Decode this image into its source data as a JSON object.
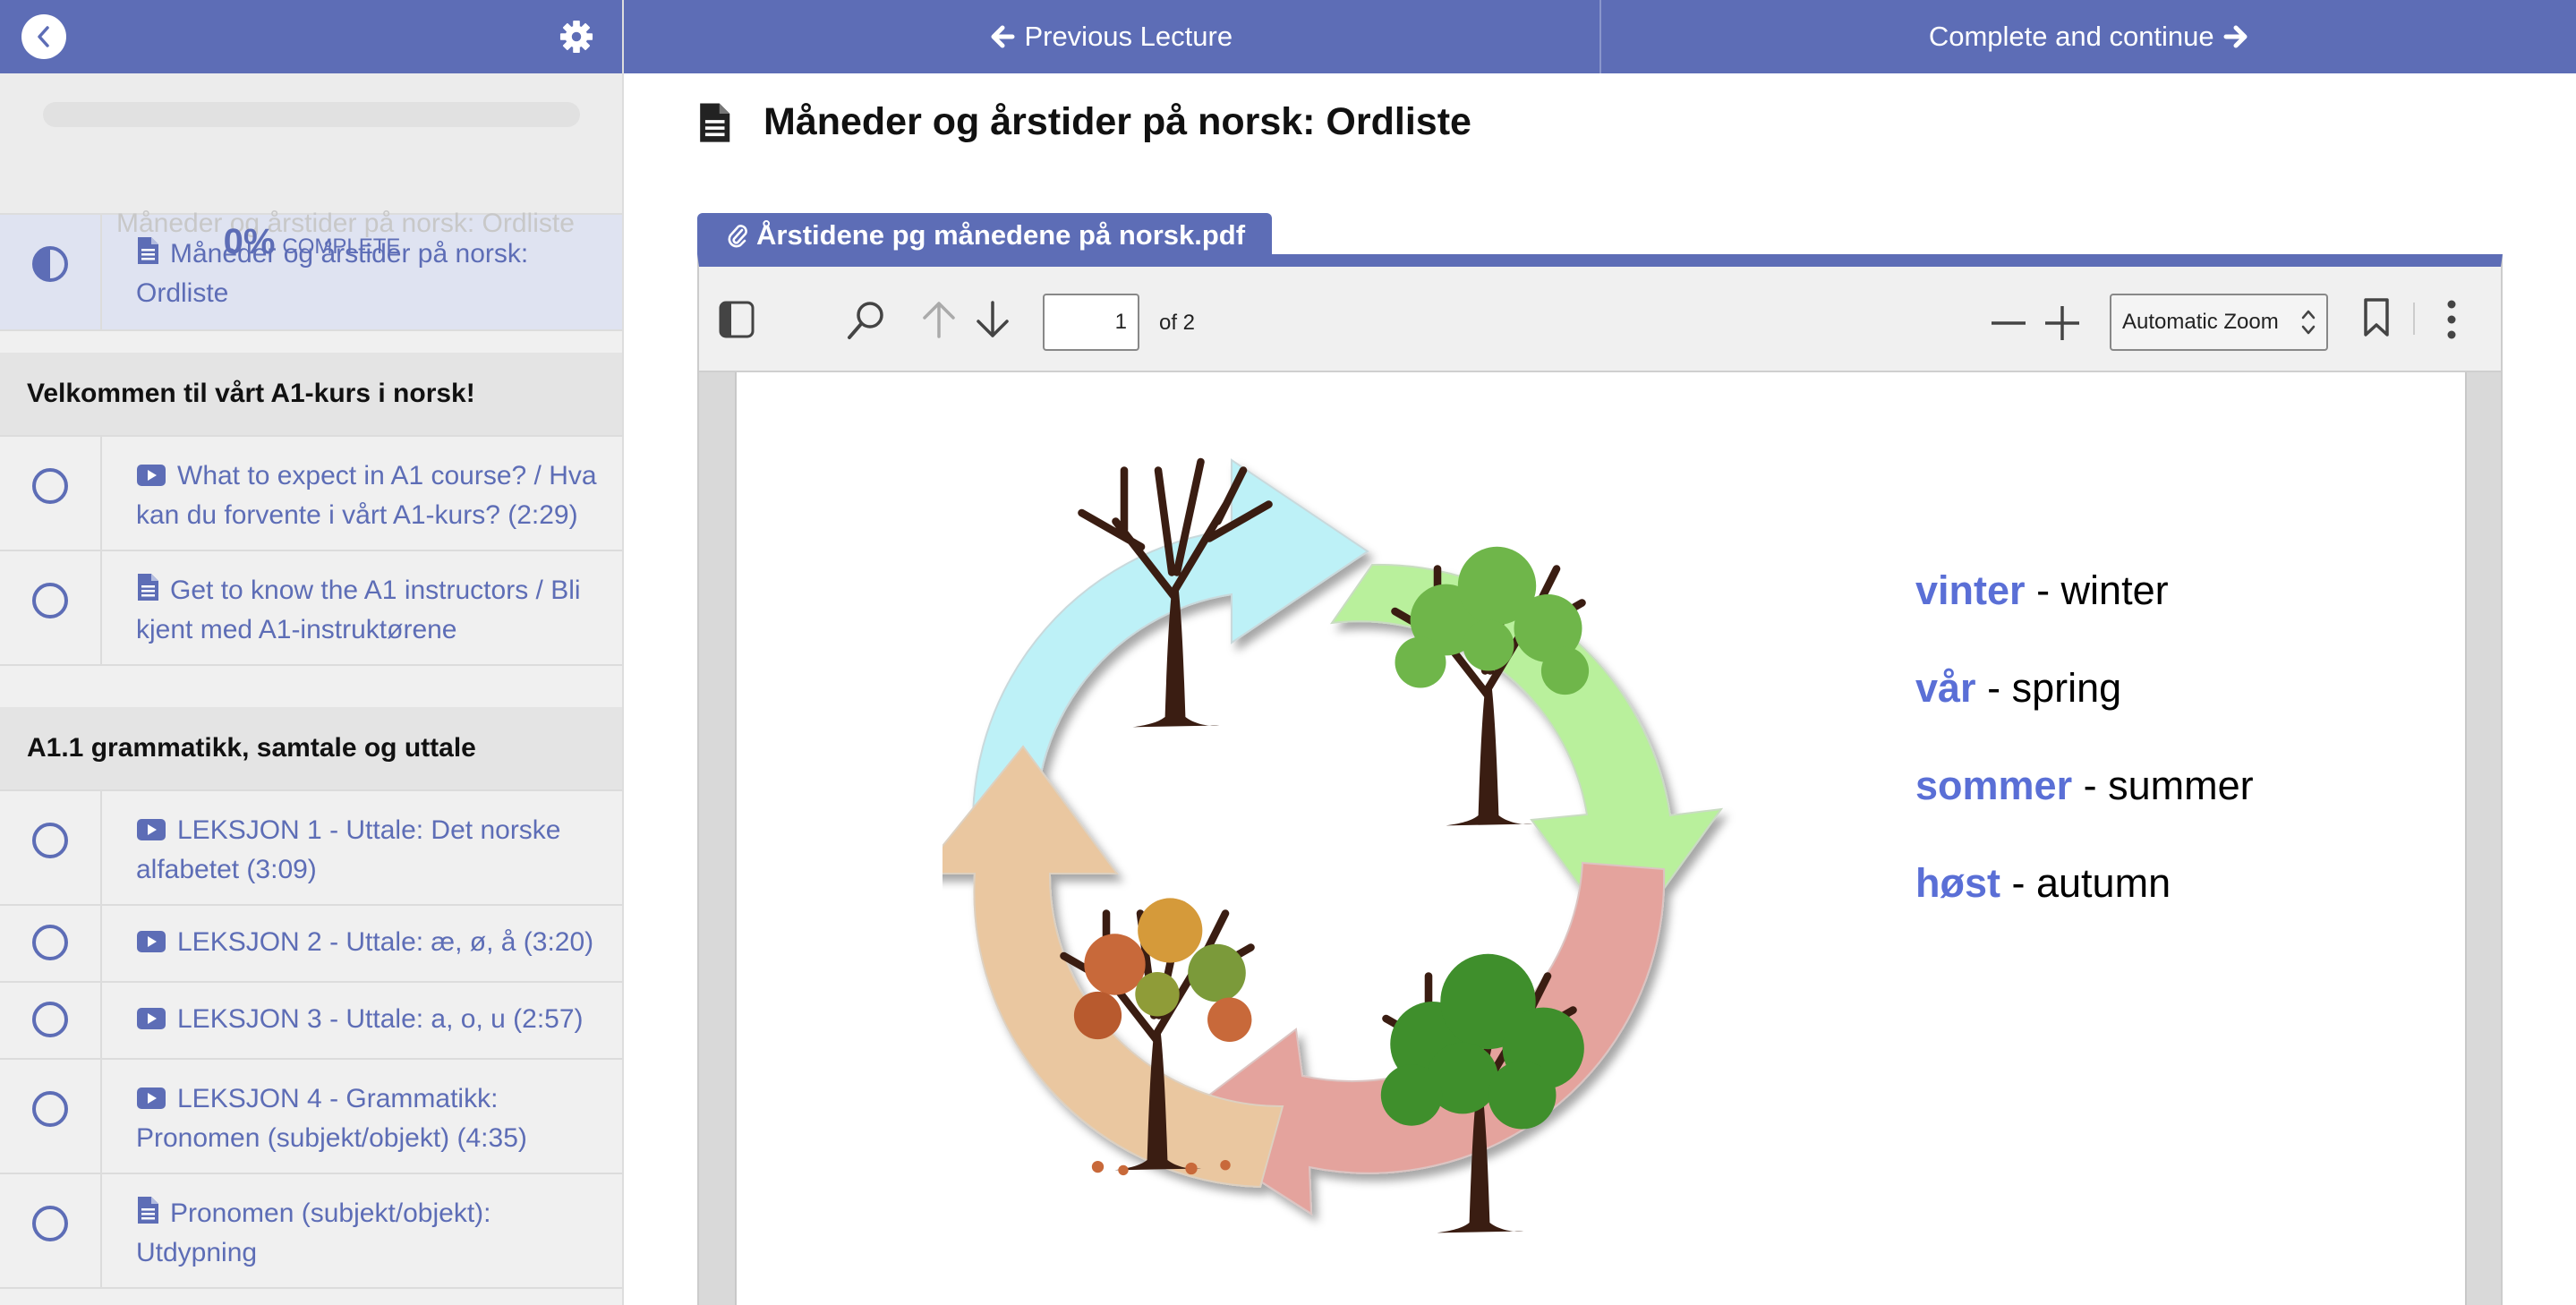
{
  "sidebar": {
    "back_icon": "chevron-left-icon",
    "settings_icon": "gear-icon",
    "progress": {
      "percent_label": "0%",
      "complete_label": "COMPLETE",
      "value": 0
    },
    "ghost_text": "Måneder og årstider på norsk: Ordliste",
    "active_lecture": {
      "icon": "file-text-icon",
      "label": "Måneder og årstider på norsk: Ordliste",
      "status": "half-complete"
    },
    "sections": [
      {
        "title": "Velkommen til vårt A1-kurs i norsk!",
        "lectures": [
          {
            "icon": "video-icon",
            "label": "What to expect in A1 course? / Hva kan du forvente i vårt A1-kurs? (2:29)"
          },
          {
            "icon": "file-text-icon",
            "label": "Get to know the A1 instructors / Bli kjent med A1-instruktørene"
          }
        ]
      },
      {
        "title": "A1.1 grammatikk, samtale og uttale",
        "lectures": [
          {
            "icon": "video-icon",
            "label": "LEKSJON 1 - Uttale: Det norske alfabetet (3:09)"
          },
          {
            "icon": "video-icon",
            "label": "LEKSJON 2 - Uttale: æ, ø, å (3:20)"
          },
          {
            "icon": "video-icon",
            "label": "LEKSJON 3 - Uttale: a, o, u (2:57)"
          },
          {
            "icon": "video-icon",
            "label": "LEKSJON 4 - Grammatikk: Pronomen (subjekt/objekt) (4:35)"
          },
          {
            "icon": "file-text-icon",
            "label": "Pronomen (subjekt/objekt): Utdypning"
          }
        ]
      }
    ]
  },
  "topnav": {
    "previous_label": "Previous Lecture",
    "complete_label": "Complete and continue"
  },
  "lecture": {
    "title": "Måneder og årstider på norsk: Ordliste",
    "attachment_label": "Årstidene pg månedene på norsk.pdf"
  },
  "pdf_viewer": {
    "page_number": "1",
    "page_count_label": "of 2",
    "zoom_label": "Automatic Zoom",
    "vocabulary": [
      {
        "norwegian": "vinter",
        "english": "- winter"
      },
      {
        "norwegian": "vår",
        "english": "- spring"
      },
      {
        "norwegian": "sommer",
        "english": "- summer"
      },
      {
        "norwegian": "høst",
        "english": "- autumn"
      }
    ]
  },
  "colors": {
    "accent": "#5d6db6",
    "winter": "#bdf1f7",
    "spring": "#b9f09c",
    "summer": "#e4a39d",
    "autumn": "#eac7a0",
    "vocab": "#5a6fd6"
  }
}
